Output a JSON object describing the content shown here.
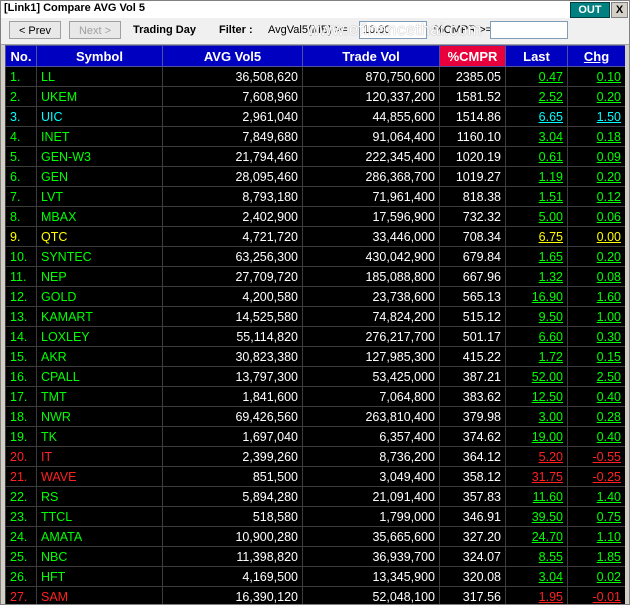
{
  "window": {
    "title": "[Link1] Compare AVG Vol 5",
    "out_label": "OUT",
    "close_label": "X"
  },
  "toolbar": {
    "prev_label": "< Prev",
    "next_label": "Next >",
    "period_label": "Trading Day",
    "filter_label": "Filter :",
    "avgvol_label": "AvgVal5(MB) >=",
    "avgvol_value": "10.00",
    "cmpr_label": "%CMPR >=",
    "cmpr_value": "",
    "watermark": "www.efinancethai.com"
  },
  "table": {
    "columns": [
      "No.",
      "Symbol",
      "AVG Vol5",
      "Trade Vol",
      "%CMPR",
      "Last",
      "Chg"
    ],
    "colors": {
      "up": "#00ff00",
      "unchanged": "#ffff00",
      "down": "#ff2020",
      "ceiling": "#00ffff"
    },
    "rows": [
      {
        "no": "1.",
        "symbol": "LL",
        "avg": "36,508,620",
        "vol": "870,750,600",
        "cmpr": "2385.05",
        "last": "0.47",
        "chg": "0.10",
        "tone": "up"
      },
      {
        "no": "2.",
        "symbol": "UKEM",
        "avg": "7,608,960",
        "vol": "120,337,200",
        "cmpr": "1581.52",
        "last": "2.52",
        "chg": "0.20",
        "tone": "up"
      },
      {
        "no": "3.",
        "symbol": "UIC",
        "avg": "2,961,040",
        "vol": "44,855,600",
        "cmpr": "1514.86",
        "last": "6.65",
        "chg": "1.50",
        "tone": "ceiling"
      },
      {
        "no": "4.",
        "symbol": "INET",
        "avg": "7,849,680",
        "vol": "91,064,400",
        "cmpr": "1160.10",
        "last": "3.04",
        "chg": "0.18",
        "tone": "up"
      },
      {
        "no": "5.",
        "symbol": "GEN-W3",
        "avg": "21,794,460",
        "vol": "222,345,400",
        "cmpr": "1020.19",
        "last": "0.61",
        "chg": "0.09",
        "tone": "up"
      },
      {
        "no": "6.",
        "symbol": "GEN",
        "avg": "28,095,460",
        "vol": "286,368,700",
        "cmpr": "1019.27",
        "last": "1.19",
        "chg": "0.20",
        "tone": "up"
      },
      {
        "no": "7.",
        "symbol": "LVT",
        "avg": "8,793,180",
        "vol": "71,961,400",
        "cmpr": "818.38",
        "last": "1.51",
        "chg": "0.12",
        "tone": "up"
      },
      {
        "no": "8.",
        "symbol": "MBAX",
        "avg": "2,402,900",
        "vol": "17,596,900",
        "cmpr": "732.32",
        "last": "5.00",
        "chg": "0.06",
        "tone": "up"
      },
      {
        "no": "9.",
        "symbol": "QTC",
        "avg": "4,721,720",
        "vol": "33,446,000",
        "cmpr": "708.34",
        "last": "6.75",
        "chg": "0.00",
        "tone": "unchanged"
      },
      {
        "no": "10.",
        "symbol": "SYNTEC",
        "avg": "63,256,300",
        "vol": "430,042,900",
        "cmpr": "679.84",
        "last": "1.65",
        "chg": "0.20",
        "tone": "up"
      },
      {
        "no": "11.",
        "symbol": "NEP",
        "avg": "27,709,720",
        "vol": "185,088,800",
        "cmpr": "667.96",
        "last": "1.32",
        "chg": "0.08",
        "tone": "up"
      },
      {
        "no": "12.",
        "symbol": "GOLD",
        "avg": "4,200,580",
        "vol": "23,738,600",
        "cmpr": "565.13",
        "last": "16.90",
        "chg": "1.60",
        "tone": "up"
      },
      {
        "no": "13.",
        "symbol": "KAMART",
        "avg": "14,525,580",
        "vol": "74,824,200",
        "cmpr": "515.12",
        "last": "9.50",
        "chg": "1.00",
        "tone": "up"
      },
      {
        "no": "14.",
        "symbol": "LOXLEY",
        "avg": "55,114,820",
        "vol": "276,217,700",
        "cmpr": "501.17",
        "last": "6.60",
        "chg": "0.30",
        "tone": "up"
      },
      {
        "no": "15.",
        "symbol": "AKR",
        "avg": "30,823,380",
        "vol": "127,985,300",
        "cmpr": "415.22",
        "last": "1.72",
        "chg": "0.15",
        "tone": "up"
      },
      {
        "no": "16.",
        "symbol": "CPALL",
        "avg": "13,797,300",
        "vol": "53,425,000",
        "cmpr": "387.21",
        "last": "52.00",
        "chg": "2.50",
        "tone": "up"
      },
      {
        "no": "17.",
        "symbol": "TMT",
        "avg": "1,841,600",
        "vol": "7,064,800",
        "cmpr": "383.62",
        "last": "12.50",
        "chg": "0.40",
        "tone": "up"
      },
      {
        "no": "18.",
        "symbol": "NWR",
        "avg": "69,426,560",
        "vol": "263,810,400",
        "cmpr": "379.98",
        "last": "3.00",
        "chg": "0.28",
        "tone": "up"
      },
      {
        "no": "19.",
        "symbol": "TK",
        "avg": "1,697,040",
        "vol": "6,357,400",
        "cmpr": "374.62",
        "last": "19.00",
        "chg": "0.40",
        "tone": "up"
      },
      {
        "no": "20.",
        "symbol": "IT",
        "avg": "2,399,260",
        "vol": "8,736,200",
        "cmpr": "364.12",
        "last": "5.20",
        "chg": "-0.55",
        "tone": "down"
      },
      {
        "no": "21.",
        "symbol": "WAVE",
        "avg": "851,500",
        "vol": "3,049,400",
        "cmpr": "358.12",
        "last": "31.75",
        "chg": "-0.25",
        "tone": "down"
      },
      {
        "no": "22.",
        "symbol": "RS",
        "avg": "5,894,280",
        "vol": "21,091,400",
        "cmpr": "357.83",
        "last": "11.60",
        "chg": "1.40",
        "tone": "up"
      },
      {
        "no": "23.",
        "symbol": "TTCL",
        "avg": "518,580",
        "vol": "1,799,000",
        "cmpr": "346.91",
        "last": "39.50",
        "chg": "0.75",
        "tone": "up"
      },
      {
        "no": "24.",
        "symbol": "AMATA",
        "avg": "10,900,280",
        "vol": "35,665,600",
        "cmpr": "327.20",
        "last": "24.70",
        "chg": "1.10",
        "tone": "up"
      },
      {
        "no": "25.",
        "symbol": "NBC",
        "avg": "11,398,820",
        "vol": "36,939,700",
        "cmpr": "324.07",
        "last": "8.55",
        "chg": "1.85",
        "tone": "up"
      },
      {
        "no": "26.",
        "symbol": "HFT",
        "avg": "4,169,500",
        "vol": "13,345,900",
        "cmpr": "320.08",
        "last": "3.04",
        "chg": "0.02",
        "tone": "up"
      },
      {
        "no": "27.",
        "symbol": "SAM",
        "avg": "16,390,120",
        "vol": "52,048,100",
        "cmpr": "317.56",
        "last": "1.95",
        "chg": "-0.01",
        "tone": "down"
      }
    ]
  }
}
